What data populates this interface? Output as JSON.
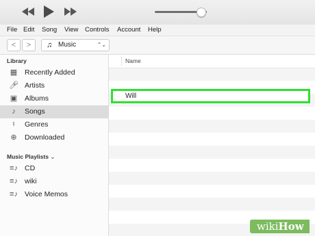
{
  "transport": {
    "rewind_icon": "rewind-icon",
    "play_icon": "play-icon",
    "fast_forward_icon": "fast-forward-icon",
    "volume": 0.9
  },
  "menu": [
    "File",
    "Edit",
    "Song",
    "View",
    "Controls",
    "Account",
    "Help"
  ],
  "nav": {
    "back": "<",
    "forward": ">",
    "media_selector": "Music"
  },
  "sidebar": {
    "library_title": "Library",
    "library_items": [
      {
        "label": "Recently Added",
        "icon": "grid-icon"
      },
      {
        "label": "Artists",
        "icon": "microphone-icon"
      },
      {
        "label": "Albums",
        "icon": "album-icon"
      },
      {
        "label": "Songs",
        "icon": "note-icon",
        "selected": true
      },
      {
        "label": "Genres",
        "icon": "genres-icon"
      },
      {
        "label": "Downloaded",
        "icon": "download-icon"
      }
    ],
    "playlists_title": "Music Playlists",
    "playlists": [
      {
        "label": "CD",
        "icon": "playlist-icon"
      },
      {
        "label": "wiki",
        "icon": "playlist-icon"
      },
      {
        "label": "Voice Memos",
        "icon": "playlist-icon"
      }
    ]
  },
  "main": {
    "column_header": "Name",
    "songs": [
      "Will"
    ],
    "highlight_color": "#2fe02f"
  },
  "watermark": {
    "part1": "wiki",
    "part2": "How"
  }
}
